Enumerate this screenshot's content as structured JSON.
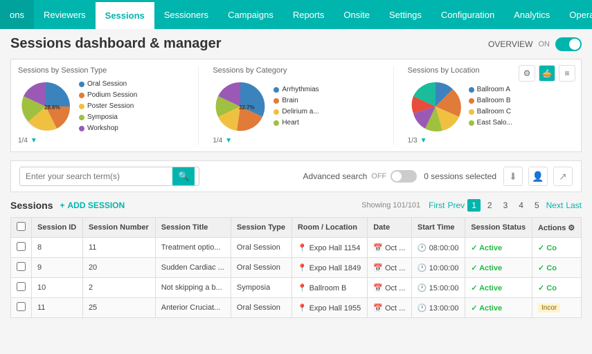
{
  "nav": {
    "items": [
      {
        "label": "ons",
        "active": false
      },
      {
        "label": "Reviewers",
        "active": false
      },
      {
        "label": "Sessions",
        "active": true
      },
      {
        "label": "Sessioners",
        "active": false
      },
      {
        "label": "Campaigns",
        "active": false
      },
      {
        "label": "Reports",
        "active": false
      },
      {
        "label": "Onsite",
        "active": false
      },
      {
        "label": "Settings",
        "active": false
      },
      {
        "label": "Configuration",
        "active": false
      },
      {
        "label": "Analytics",
        "active": false
      },
      {
        "label": "Operation",
        "active": false
      }
    ]
  },
  "page": {
    "title": "Sessions dashboard & manager",
    "overview_label": "OVERVIEW",
    "overview_on": "ON"
  },
  "charts": {
    "type_title": "Sessions by Session Type",
    "category_title": "Sessions by Category",
    "location_title": "Sessions by Location",
    "type_nav": "1/4",
    "category_nav": "1/4",
    "location_nav": "1/3",
    "type_slices": [
      {
        "color": "#3b83bd",
        "pct": 28.6,
        "label": "Oral Session"
      },
      {
        "color": "#e07b39",
        "pct": 17.8,
        "label": "Podium Session"
      },
      {
        "color": "#f0c040",
        "pct": 23.8,
        "label": "Poster Session"
      },
      {
        "color": "#a0c040",
        "pct": 15.2,
        "label": "Symposia"
      },
      {
        "color": "#9b59b6",
        "pct": 14.6,
        "label": "Workshop"
      }
    ],
    "category_slices": [
      {
        "color": "#3b83bd",
        "pct": 32.7,
        "label": "Arrhythmias"
      },
      {
        "color": "#e07b39",
        "pct": 21.8,
        "label": "Brain"
      },
      {
        "color": "#f0c040",
        "pct": 18.0,
        "label": "Delirium a..."
      },
      {
        "color": "#a0c040",
        "pct": 15.0,
        "label": "Heart"
      },
      {
        "color": "#9b59b6",
        "pct": 12.5,
        "label": "..."
      }
    ],
    "location_slices": [
      {
        "color": "#3b83bd",
        "pct": 20,
        "label": "Ballroom A"
      },
      {
        "color": "#e07b39",
        "pct": 18,
        "label": "Ballroom B"
      },
      {
        "color": "#f0c040",
        "pct": 16,
        "label": "Ballroom C"
      },
      {
        "color": "#a0c040",
        "pct": 14,
        "label": "East Salo..."
      },
      {
        "color": "#9b59b6",
        "pct": 12,
        "label": "..."
      },
      {
        "color": "#e74c3c",
        "pct": 10,
        "label": "..."
      },
      {
        "color": "#1abc9c",
        "pct": 10,
        "label": "..."
      }
    ]
  },
  "search": {
    "placeholder": "Enter your search term(s)",
    "advanced_label": "Advanced search",
    "toggle_state": "OFF",
    "sessions_selected": "0 sessions selected"
  },
  "sessions": {
    "label": "Sessions",
    "add_label": "ADD SESSION",
    "showing": "Showing 101/101",
    "first": "First",
    "prev": "Prev",
    "pages": [
      "1",
      "2",
      "3",
      "4",
      "5"
    ],
    "next": "Next",
    "last": "Last",
    "current_page": "1"
  },
  "table": {
    "columns": [
      "",
      "Session ID",
      "Session Number",
      "Session Title",
      "Session Type",
      "Room / Location",
      "Date",
      "Start Time",
      "Session Status",
      "Actions"
    ],
    "rows": [
      {
        "id": "8",
        "number": "11",
        "title": "Treatment optio...",
        "type": "Oral Session",
        "location": "Expo Hall 1154",
        "date": "Oct ...",
        "start_time": "08:00:00",
        "status": "Active",
        "action": "Co"
      },
      {
        "id": "9",
        "number": "20",
        "title": "Sudden Cardiac ...",
        "type": "Oral Session",
        "location": "Expo Hall 1849",
        "date": "Oct ...",
        "start_time": "10:00:00",
        "status": "Active",
        "action": "Co"
      },
      {
        "id": "10",
        "number": "2",
        "title": "Not skipping a b...",
        "type": "Symposia",
        "location": "Ballroom B",
        "date": "Oct ...",
        "start_time": "15:00:00",
        "status": "Active",
        "action": "Co"
      },
      {
        "id": "11",
        "number": "25",
        "title": "Anterior Cruciat...",
        "type": "Oral Session",
        "location": "Expo Hall 1955",
        "date": "Oct ...",
        "start_time": "13:00:00",
        "status": "Active",
        "action": "Incor"
      }
    ]
  }
}
